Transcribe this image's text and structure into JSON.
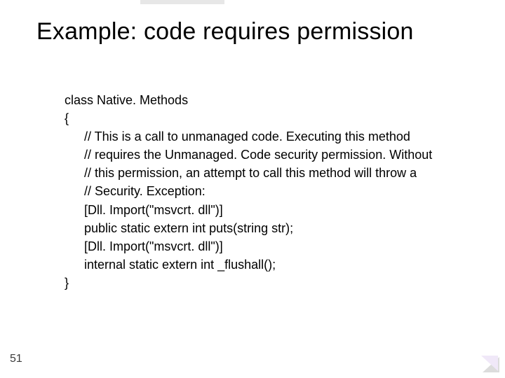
{
  "title": "Example: code requires permission",
  "code": {
    "l0": "class Native. Methods",
    "l1": "{",
    "l2": "// This is a call to unmanaged code. Executing this method",
    "l3": "// requires the Unmanaged. Code security permission. Without",
    "l4": "// this permission, an attempt to call this method will throw a",
    "l5": "// Security. Exception:",
    "l6": "[Dll. Import(\"msvcrt. dll\")]",
    "l7": "public static extern int puts(string str);",
    "l8": "[Dll. Import(\"msvcrt. dll\")]",
    "l9": "internal static extern int _flushall();",
    "l10": "}"
  },
  "page_number": "51"
}
